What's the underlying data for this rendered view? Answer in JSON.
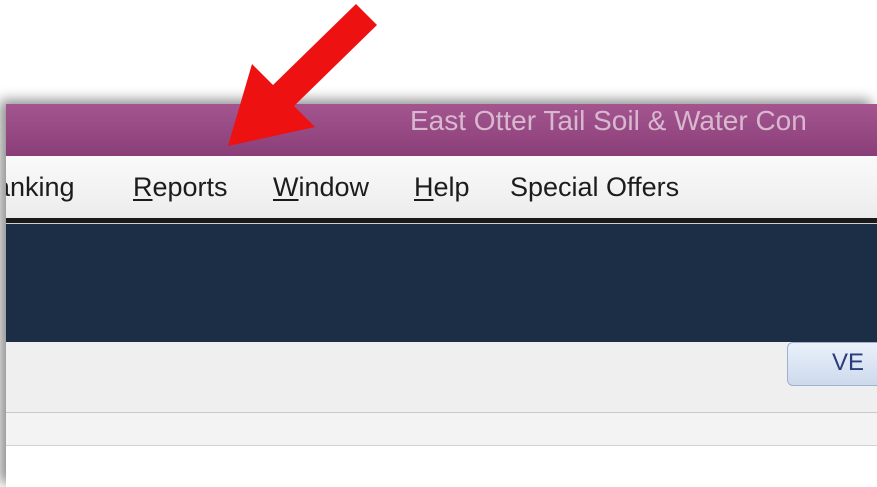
{
  "window": {
    "title": "East Otter Tail Soil & Water Con"
  },
  "menubar": {
    "items": [
      {
        "label": "anking",
        "mnemonic": "",
        "rest": ""
      },
      {
        "label": "Reports",
        "mnemonic": "R",
        "rest": "eports"
      },
      {
        "label": "Window",
        "mnemonic": "W",
        "rest": "indow"
      },
      {
        "label": "Help",
        "mnemonic": "H",
        "rest": "elp"
      },
      {
        "label": "Special Offers",
        "mnemonic": "",
        "rest": ""
      }
    ]
  },
  "content": {
    "button_label": "VE"
  },
  "annotation": {
    "arrow_icon": "red-arrow-icon",
    "arrow_color": "#ee1111"
  },
  "colors": {
    "titlebar": "#8a3e78",
    "navband": "#1c2e46",
    "menubar": "#f2f2f2"
  }
}
